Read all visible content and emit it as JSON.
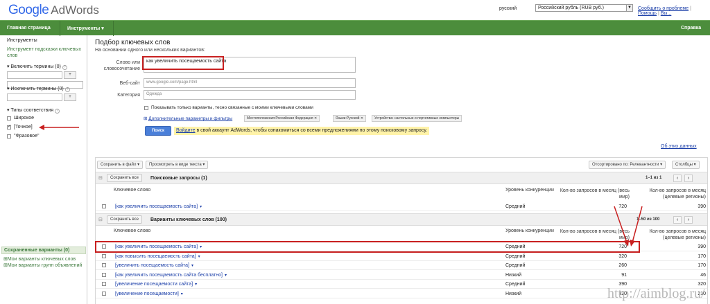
{
  "header": {
    "brand_google": "Google",
    "brand_product": "AdWords",
    "language": "русский",
    "currency": "Российский рубль (RUB руб.)",
    "report_link": "Сообщить о проблеме",
    "help_link": "Помощь",
    "logout_link": "Вы..."
  },
  "nav": {
    "home": "Главная страница",
    "tools": "Инструменты ▾",
    "help": "Справка"
  },
  "sidebar": {
    "title": "Инструменты",
    "tool_link": "Инструмент подсказки ключевых слов",
    "include_terms": "Включить термины (0)",
    "exclude_terms": "Исключить термины (0)",
    "add_btn": "+",
    "match_types": "Типы соответствия",
    "broad": "Широкое",
    "exact": "[Точное]",
    "phrase": "\"Фразовое\"",
    "saved_title": "Сохраненные варианты (0)",
    "my_keywords": "Мои варианты ключевых слов",
    "my_groups": "Мои варианты групп объявлений"
  },
  "form": {
    "title": "Подбор ключевых слов",
    "subtitle": "На основании одного или нескольких вариантов:",
    "word_label_1": "Слово или",
    "word_label_2": "словосочетание",
    "word_value": "как увеличить посещаемость сайта",
    "website_label": "Веб-сайт",
    "website_placeholder": "www.google.com/page.html",
    "category_label": "Категория",
    "category_placeholder": "Одежда",
    "only_close": "Показывать только варианты, тесно связанные с моими ключевыми словами",
    "advanced": "Дополнительные параметры и фильтры",
    "chip_location": "Местоположения:Российская Федерация",
    "chip_language": "Языки:Русский",
    "chip_devices": "Устройства: настольные и портативные компьютеры",
    "search_btn": "Поиск",
    "notice_link": "Войдите",
    "notice_text": " в свой аккаунт AdWords, чтобы ознакомиться со всеми предложениями по этому поисковому запросу.",
    "about_data": "Об этих данных"
  },
  "toolbar": {
    "save_file": "Сохранить в файл ▾",
    "view_text": "Просмотреть в виде текста ▾",
    "sorted": "Отсортировано по: Релевантности ▾",
    "columns": "Столбцы ▾"
  },
  "table": {
    "save_all": "Сохранить все",
    "section1_title": "Поисковые запросы (1)",
    "section1_pager": "1–1 из 1",
    "section2_title": "Варианты ключевых слов (100)",
    "section2_pager": "1–50 из 100",
    "col_keyword": "Ключевое слово",
    "col_competition": "Уровень конкуренции",
    "col_global_1": "Кол-во запросов в месяц (весь",
    "col_global_2": "мир)",
    "col_local_1": "Кол-во запросов в месяц",
    "col_local_2": "(целевые регионы)",
    "pager_prev": "‹",
    "pager_next": "›",
    "search_rows": [
      {
        "keyword": "[как увеличить посещаемость сайта]",
        "competition": "Средний",
        "global": "720",
        "local": "390"
      }
    ],
    "variant_rows": [
      {
        "keyword": "[как увеличить посещаемость сайта]",
        "competition": "Средний",
        "global": "720",
        "local": "390"
      },
      {
        "keyword": "[как повысить посещаемость сайта]",
        "competition": "Средний",
        "global": "320",
        "local": "170"
      },
      {
        "keyword": "[увеличить посещаемость сайта]",
        "competition": "Средний",
        "global": "260",
        "local": "170"
      },
      {
        "keyword": "[как увеличить посещаемость сайта бесплатно]",
        "competition": "Низкий",
        "global": "91",
        "local": "46"
      },
      {
        "keyword": "[увеличение посещаемости сайта]",
        "competition": "Средний",
        "global": "390",
        "local": "320"
      },
      {
        "keyword": "[увеличение посещаемости]",
        "competition": "Низкий",
        "global": "320",
        "local": "210"
      }
    ]
  },
  "watermark": "http://aimblog.ru/",
  "colors": {
    "nav_green": "#4c8d3c",
    "link_blue": "#1a3ea8",
    "highlight_red": "#c82020",
    "notice_yellow": "#fff3a8"
  }
}
